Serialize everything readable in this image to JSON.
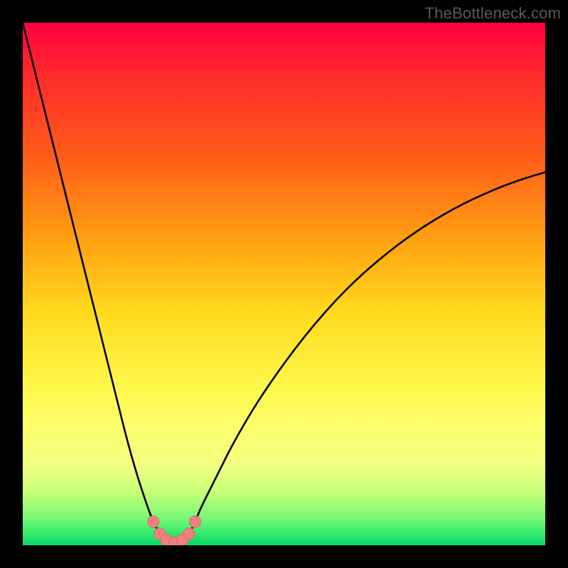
{
  "watermark": "TheBottleneck.com",
  "colors": {
    "frame": "#000000",
    "curve": "#000000",
    "marker_fill": "#f08080",
    "marker_stroke": "#e06868"
  },
  "chart_data": {
    "type": "line",
    "title": "",
    "xlabel": "",
    "ylabel": "",
    "xlim": [
      0,
      100
    ],
    "ylim": [
      0,
      100
    ],
    "grid": false,
    "series": [
      {
        "name": "bottleneck-curve",
        "x": [
          0,
          2,
          4,
          6,
          8,
          10,
          12,
          14,
          16,
          18,
          20,
          22,
          24,
          25,
          26,
          27,
          28,
          29,
          30,
          31,
          32,
          33,
          34,
          36,
          38,
          40,
          44,
          48,
          52,
          56,
          60,
          64,
          68,
          72,
          76,
          80,
          84,
          88,
          92,
          96,
          100
        ],
        "y": [
          100,
          92,
          84,
          76,
          68,
          60,
          52,
          44,
          36,
          28,
          20,
          13,
          7,
          4.5,
          2.5,
          1.2,
          0.6,
          0.5,
          0.6,
          1.2,
          2.5,
          4.5,
          7,
          11,
          15,
          19,
          26,
          32,
          37.5,
          42.5,
          47,
          51,
          54.5,
          57.7,
          60.5,
          63,
          65.2,
          67.1,
          68.8,
          70.2,
          71.4
        ]
      }
    ],
    "markers": {
      "name": "bottleneck-sweet-spot",
      "x": [
        25,
        26.2,
        27.5,
        29,
        30.5,
        31.8,
        33
      ],
      "y": [
        4.5,
        2.2,
        1.0,
        0.5,
        1.0,
        2.2,
        4.5
      ],
      "r": 1.1
    }
  }
}
